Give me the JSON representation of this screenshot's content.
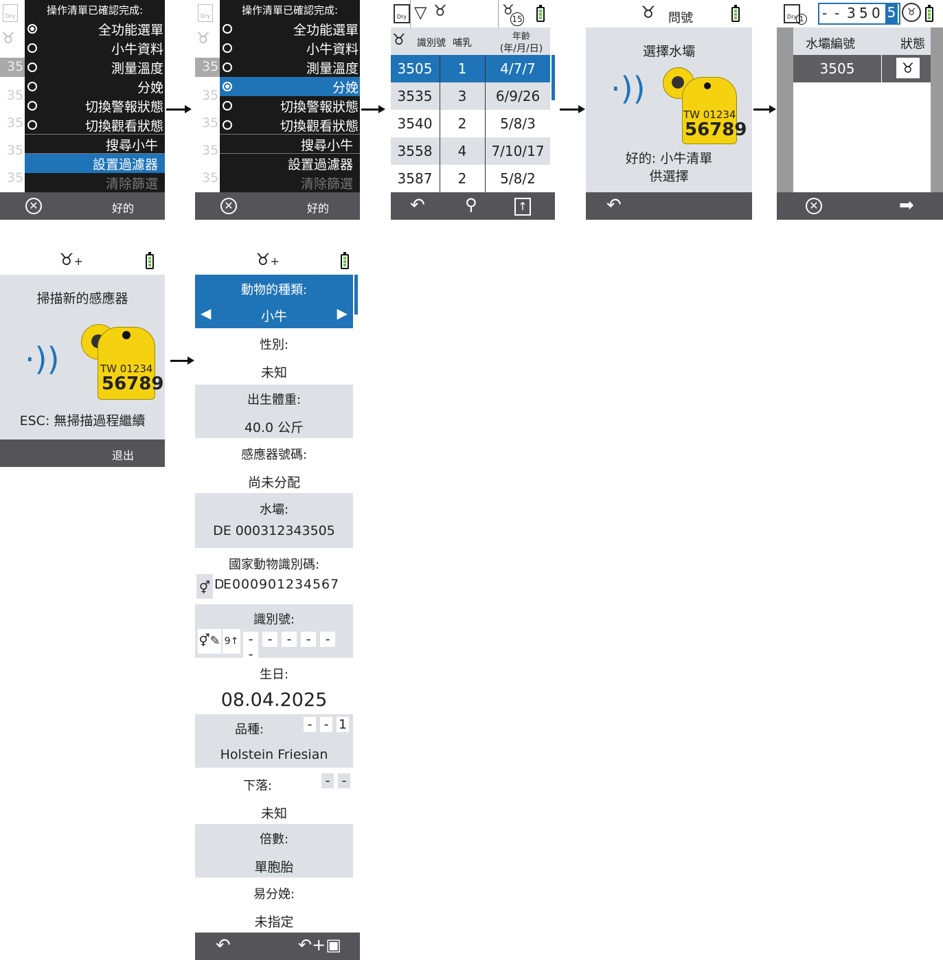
{
  "menu": {
    "title": "操作清單已確認完成:",
    "items": [
      {
        "label": "全功能選單",
        "radio": true
      },
      {
        "label": "小牛資料",
        "radio": true
      },
      {
        "label": "測量溫度",
        "radio": true
      },
      {
        "label": "分娩",
        "radio": true
      },
      {
        "label": "切換警報狀態",
        "radio": true
      },
      {
        "label": "切換觀看狀態",
        "radio": true
      },
      {
        "label": "搜尋小牛",
        "radio": false
      },
      {
        "label": "設置過濾器",
        "radio": false
      },
      {
        "label": "清除篩選",
        "radio": false
      }
    ],
    "bg_id": "35",
    "ok_label": "好的",
    "dry_label": "Dry"
  },
  "list": {
    "col_id": "識別號",
    "col_feed": "哺乳",
    "col_age_line1": "年齡",
    "col_age_line2": "(年/月/日)",
    "herd_count": "15",
    "dry_label": "Dry",
    "rows": [
      {
        "id": "3505",
        "feed": "1",
        "age": "4/7/7"
      },
      {
        "id": "3535",
        "feed": "3",
        "age": "6/9/26"
      },
      {
        "id": "3540",
        "feed": "2",
        "age": "5/8/3"
      },
      {
        "id": "3558",
        "feed": "4",
        "age": "7/10/17"
      },
      {
        "id": "3587",
        "feed": "2",
        "age": "5/8/2"
      }
    ]
  },
  "select_teat": {
    "header": "問號",
    "title": "選擇水壩",
    "tag_text1": "TW 01234",
    "tag_text2": "56789",
    "msg_line1": "好的: 小牛清單",
    "msg_line2": "供選擇"
  },
  "teat_list": {
    "dry_label": "Dry",
    "dry_count": "1",
    "digits": [
      "-",
      "-",
      "3",
      "5",
      "0",
      "5"
    ],
    "col_teat": "水壩編號",
    "col_status": "狀態",
    "row_id": "3505"
  },
  "scan": {
    "title": "掃描新的感應器",
    "tag_text1": "TW 01234",
    "tag_text2": "56789",
    "msg": "ESC: 無掃描過程繼續",
    "exit_label": "退出"
  },
  "form": {
    "animal_type_label": "動物的種類:",
    "animal_type_value": "小牛",
    "sex_label": "性別:",
    "sex_value": "未知",
    "birth_weight_label": "出生體重:",
    "birth_weight_value": "40.0 公斤",
    "sensor_label": "感應器號碼:",
    "sensor_value": "尚未分配",
    "dam_label": "水壩:",
    "dam_value": "DE 000312343505",
    "national_id_label": "國家動物識別碼:",
    "national_id_chars": [
      "D",
      "E",
      "0",
      "0",
      "0",
      "9",
      "0",
      "1",
      "2",
      "3",
      "4",
      "5",
      "6",
      "7"
    ],
    "ident_label": "識別號:",
    "ident_chars": [
      "-",
      "-",
      "-",
      "-",
      "-",
      "-"
    ],
    "birthday_label": "生日:",
    "birthday_value": "08.04.2025",
    "breed_label": "品種:",
    "breed_code": [
      "-",
      "-",
      "1"
    ],
    "breed_value": "Holstein Friesian",
    "whereabouts_label": "下落:",
    "whereabouts_code": [
      "-",
      "-"
    ],
    "whereabouts_value": "未知",
    "multiple_label": "倍數:",
    "multiple_value": "單胞胎",
    "ease_label": "易分娩:",
    "ease_value": "未指定"
  },
  "colors": {
    "accent_blue": "#1f73b7",
    "footer_gray": "#555559",
    "menu_dark": "#1a1a1a",
    "tag_yellow": "#f5d20f",
    "panel_gray": "#dde1e6"
  }
}
